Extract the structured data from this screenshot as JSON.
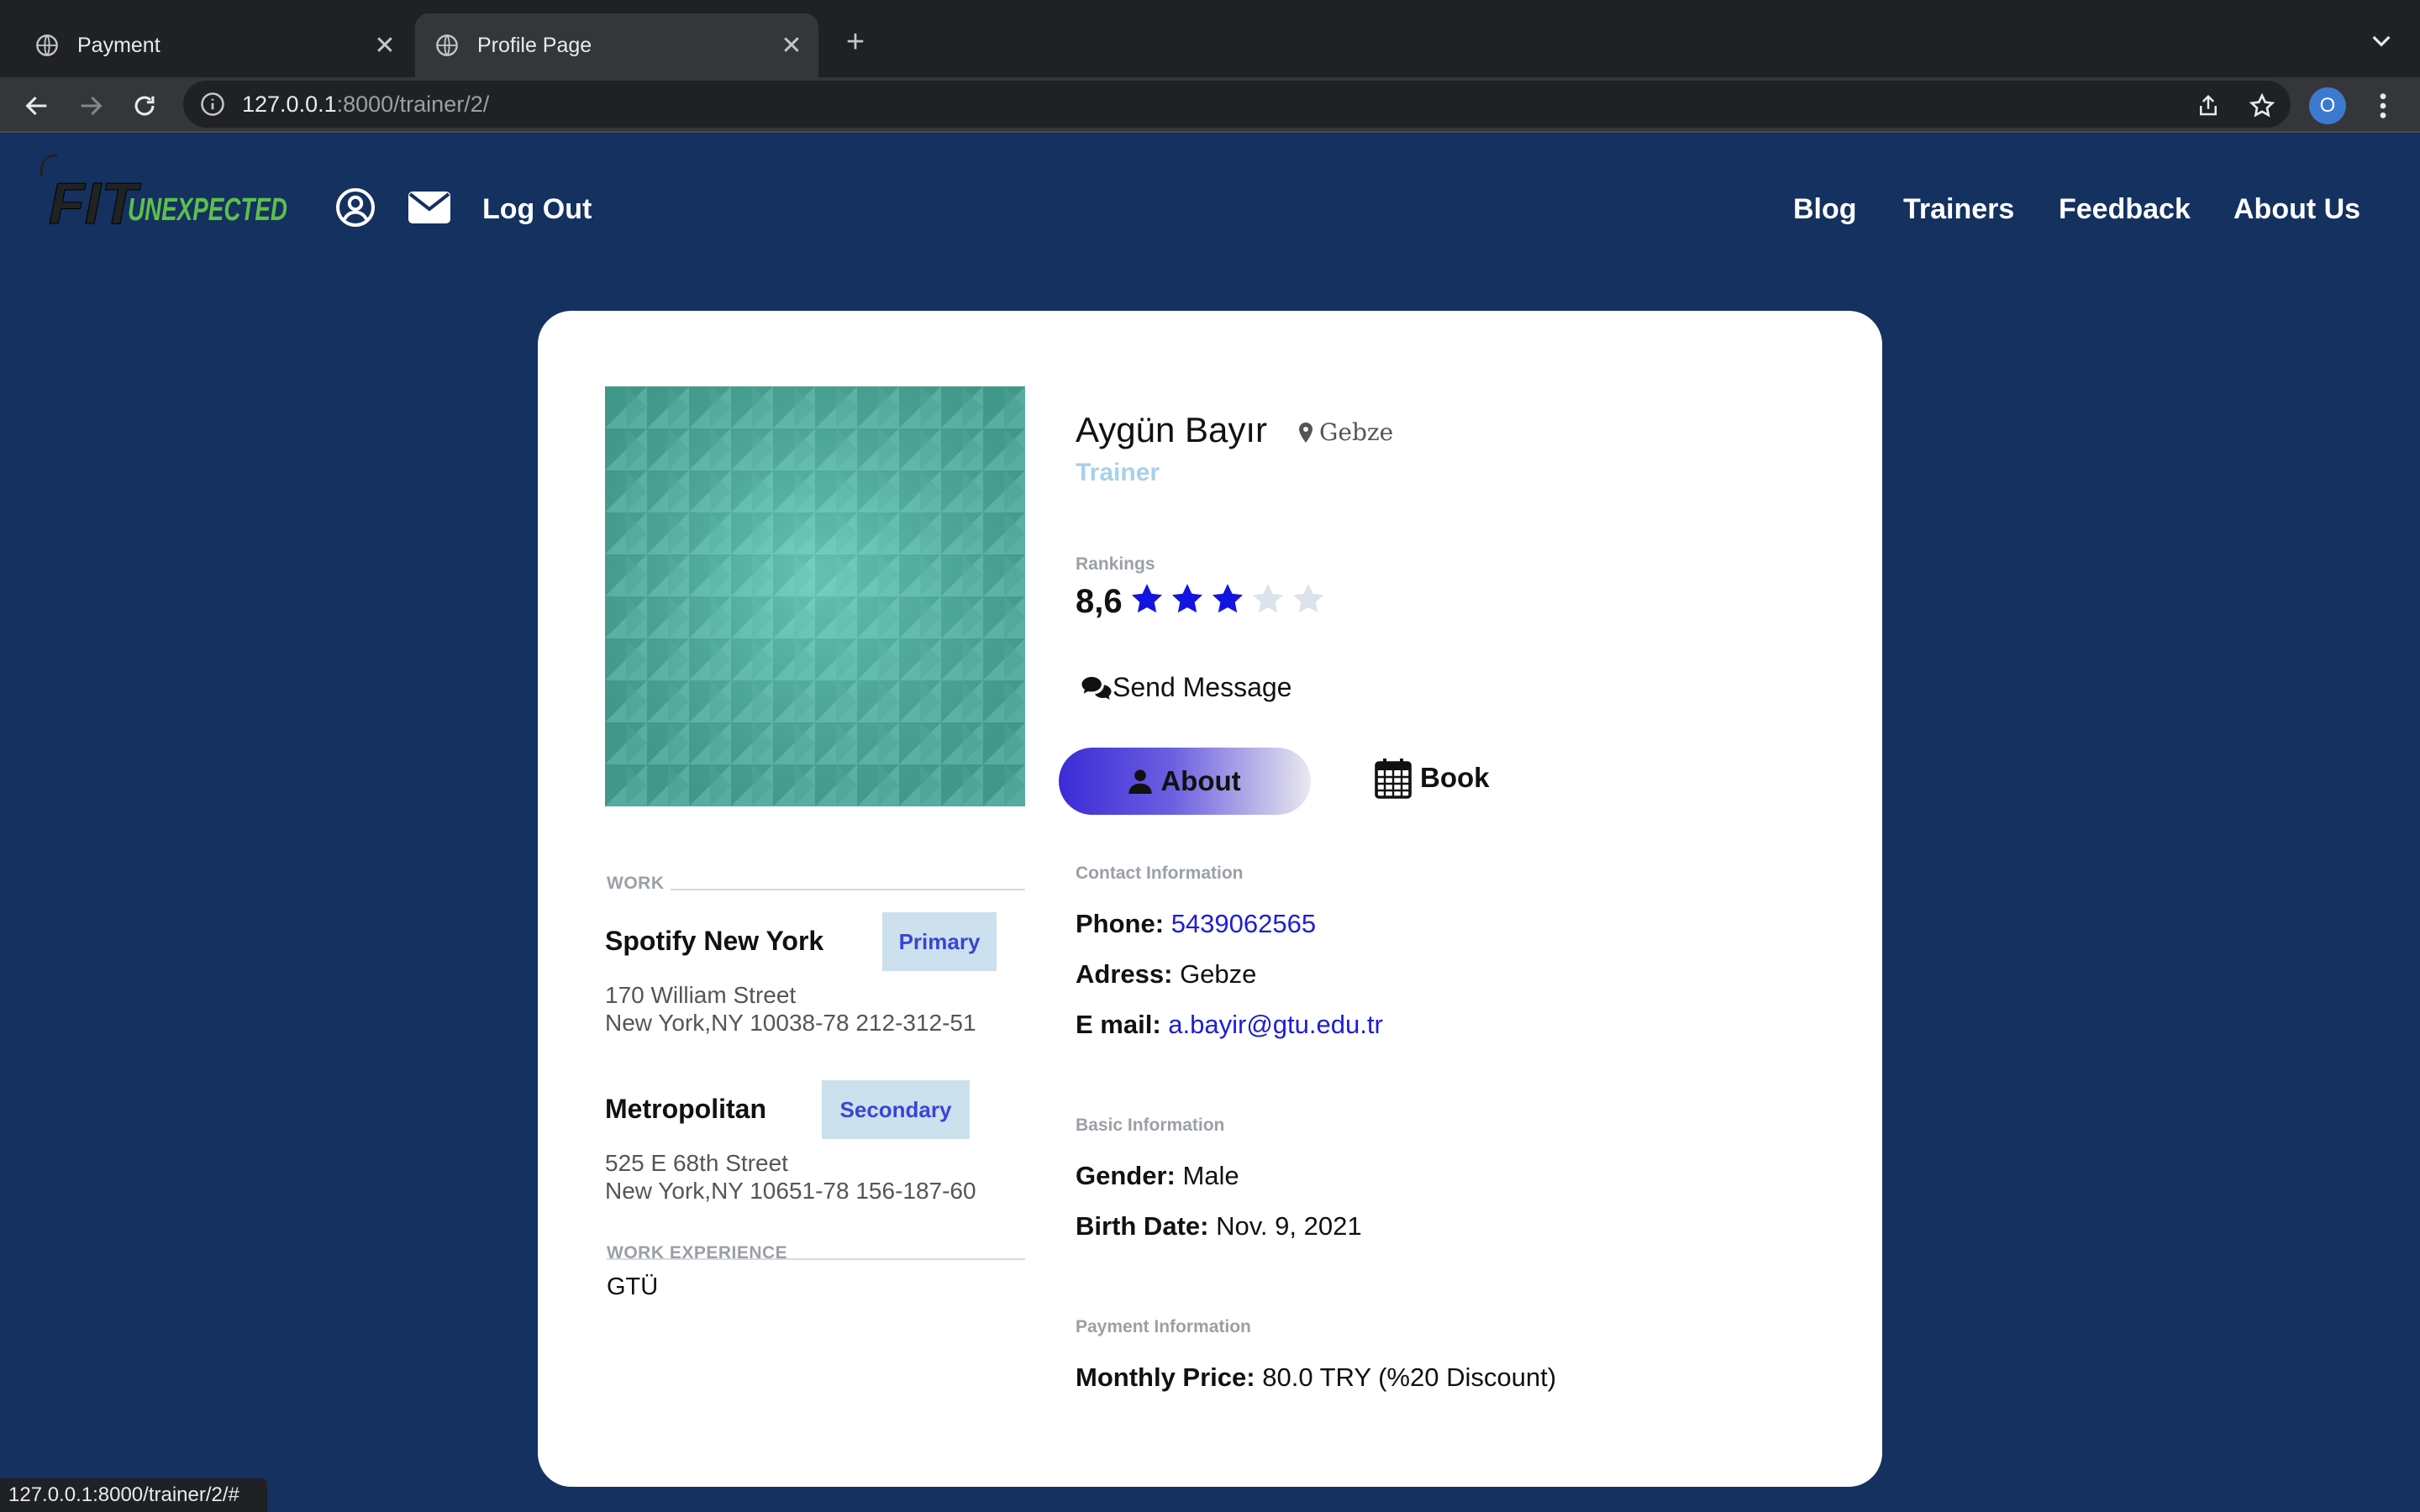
{
  "browser": {
    "tabs": [
      {
        "title": "Payment",
        "active": false
      },
      {
        "title": "Profile Page",
        "active": true
      }
    ],
    "url_host": "127.0.0.1",
    "url_rest": ":8000/trainer/2/",
    "profile_initial": "O",
    "status_url": "127.0.0.1:8000/trainer/2/#"
  },
  "site": {
    "logo_text_fit": "FIT",
    "logo_text_unexpected": "UNEXPECTED",
    "logout_label": "Log Out",
    "nav": [
      "Blog",
      "Trainers",
      "Feedback",
      "About Us"
    ]
  },
  "profile": {
    "name": "Aygün Bayır",
    "location": "Gebze",
    "role": "Trainer",
    "rankings_label": "Rankings",
    "rating_value": "8,6",
    "stars_filled": 3,
    "stars_total": 5,
    "send_message_label": "Send Message",
    "tab_about_label": "About",
    "tab_book_label": "Book"
  },
  "work": {
    "section_label": "WORK",
    "items": [
      {
        "name": "Spotify New York",
        "badge": "Primary",
        "address_line1": "170 William Street",
        "address_line2": "New York,NY 10038-78 212-312-51"
      },
      {
        "name": "Metropolitan",
        "badge": "Secondary",
        "address_line1": "525 E 68th Street",
        "address_line2": "New York,NY 10651-78 156-187-60"
      }
    ],
    "experience_label": "WORK EXPERIENCE",
    "experience_value": "GTÜ"
  },
  "contact": {
    "section_label": "Contact Information",
    "phone_label": "Phone:",
    "phone_value": "5439062565",
    "address_label": "Adress:",
    "address_value": "Gebze",
    "email_label": "E mail:",
    "email_value": "a.bayir@gtu.edu.tr"
  },
  "basic": {
    "section_label": "Basic Information",
    "gender_label": "Gender:",
    "gender_value": "Male",
    "birth_label": "Birth Date:",
    "birth_value": "Nov. 9, 2021"
  },
  "payment": {
    "section_label": "Payment Information",
    "price_label": "Monthly Price:",
    "price_value": "80.0 TRY (%20 Discount)"
  },
  "colors": {
    "page_bg": "#14315f",
    "accent_blue": "#1d1dd8",
    "star_filled": "#1414e0",
    "star_empty": "#dde3ea",
    "badge_bg": "#cce0ee"
  }
}
